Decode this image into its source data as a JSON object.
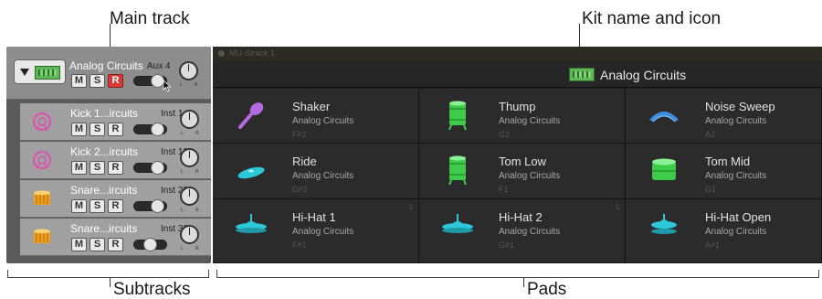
{
  "callouts": {
    "main_track": "Main track",
    "kit_name": "Kit name and icon",
    "subtracks": "Subtracks",
    "pads": "Pads"
  },
  "main_track": {
    "name": "Analog Circuits",
    "tag": "Aux 4",
    "mute": "M",
    "solo": "S",
    "record": "R",
    "record_color": "#d83a3a"
  },
  "subtracks": [
    {
      "name": "Kick 1...ircuits",
      "tag": "Inst 1",
      "mute": "M",
      "solo": "S",
      "record": "R",
      "icon": "kick-drum-icon",
      "color": "#e14fb0"
    },
    {
      "name": "Kick 2...ircuits",
      "tag": "Inst 10",
      "mute": "M",
      "solo": "S",
      "record": "R",
      "icon": "kick-drum-icon",
      "color": "#e14fb0"
    },
    {
      "name": "Snare...ircuits",
      "tag": "Inst 29",
      "mute": "M",
      "solo": "S",
      "record": "R",
      "icon": "snare-drum-icon",
      "color": "#f0a020"
    },
    {
      "name": "Snare...ircuits",
      "tag": "Inst 30",
      "mute": "M",
      "solo": "S",
      "record": "R",
      "icon": "snare-drum-icon",
      "color": "#f0a020"
    }
  ],
  "toolbar": {
    "ghost_label": "MU-Strack 1"
  },
  "kit_header": {
    "name": "Analog Circuits",
    "icon": "drum-machine-icon",
    "icon_color": "#5eb854"
  },
  "pads": [
    {
      "name": "Shaker",
      "kit": "Analog Circuits",
      "note": "F#2",
      "num": "",
      "icon": "shaker-icon",
      "color": "#b36ae2"
    },
    {
      "name": "Thump",
      "kit": "Analog Circuits",
      "note": "G2",
      "num": "",
      "icon": "drum-icon",
      "color": "#3ecb4a"
    },
    {
      "name": "Noise Sweep",
      "kit": "Analog Circuits",
      "note": "A2",
      "num": "",
      "icon": "sweep-icon",
      "color": "#3e8ee0"
    },
    {
      "name": "Ride",
      "kit": "Analog Circuits",
      "note": "D#2",
      "num": "",
      "icon": "ride-cymbal-icon",
      "color": "#2cc8d8"
    },
    {
      "name": "Tom Low",
      "kit": "Analog Circuits",
      "note": "F1",
      "num": "",
      "icon": "drum-icon",
      "color": "#3ecb4a"
    },
    {
      "name": "Tom Mid",
      "kit": "Analog Circuits",
      "note": "G1",
      "num": "",
      "icon": "tom-drum-icon",
      "color": "#3ecb4a"
    },
    {
      "name": "Hi-Hat 1",
      "kit": "Analog Circuits",
      "note": "F#1",
      "num": "1",
      "icon": "hihat-icon",
      "color": "#2cc8d8"
    },
    {
      "name": "Hi-Hat 2",
      "kit": "Analog Circuits",
      "note": "G#1",
      "num": "1",
      "icon": "hihat-icon",
      "color": "#2cc8d8"
    },
    {
      "name": "Hi-Hat Open",
      "kit": "Analog Circuits",
      "note": "A#1",
      "num": "",
      "icon": "hihat-icon",
      "color": "#2cc8d8"
    }
  ]
}
